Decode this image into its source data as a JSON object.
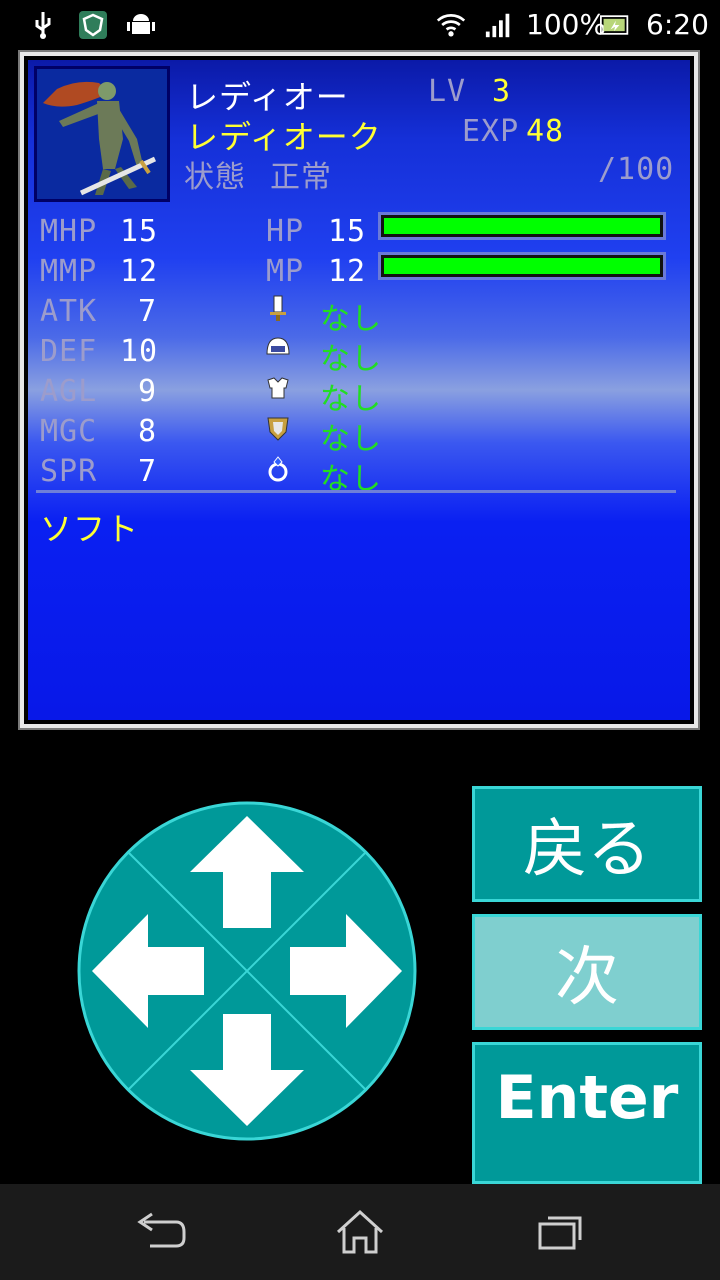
{
  "status_bar": {
    "battery": "100%",
    "time": "6:20",
    "icons": [
      "usb-icon",
      "shield-app-icon",
      "android-icon",
      "wifi-icon",
      "signal-icon",
      "battery-icon"
    ]
  },
  "character": {
    "name": "レディオー",
    "class": "レディオーク",
    "status_label": "状態",
    "status_value": "正常",
    "lv_label": "LV",
    "lv_value": "3",
    "exp_label": "EXP",
    "exp_value": "48",
    "exp_next": "/100"
  },
  "stats": {
    "mhp_label": "MHP",
    "mhp": "15",
    "mmp_label": "MMP",
    "mmp": "12",
    "atk_label": "ATK",
    "atk": "7",
    "def_label": "DEF",
    "def": "10",
    "agl_label": "AGL",
    "agl": "9",
    "mgc_label": "MGC",
    "mgc": "8",
    "spr_label": "SPR",
    "spr": "7",
    "hp_label": "HP",
    "hp": "15",
    "hp_fraction": 1.0,
    "mp_label": "MP",
    "mp": "12",
    "mp_fraction": 1.0
  },
  "equipment": [
    {
      "icon": "sword-icon",
      "value": "なし"
    },
    {
      "icon": "helmet-icon",
      "value": "なし"
    },
    {
      "icon": "armor-icon",
      "value": "なし"
    },
    {
      "icon": "shield-icon",
      "value": "なし"
    },
    {
      "icon": "ring-icon",
      "value": "なし"
    }
  ],
  "description": "ソフト",
  "controls": {
    "back_label": "戻る",
    "next_label": "次",
    "enter_label": "Enter"
  },
  "colors": {
    "hp_bar": "#00ff00",
    "button": "#009999",
    "button_light": "#7fcfcf",
    "panel_blue": "#0818e8"
  }
}
